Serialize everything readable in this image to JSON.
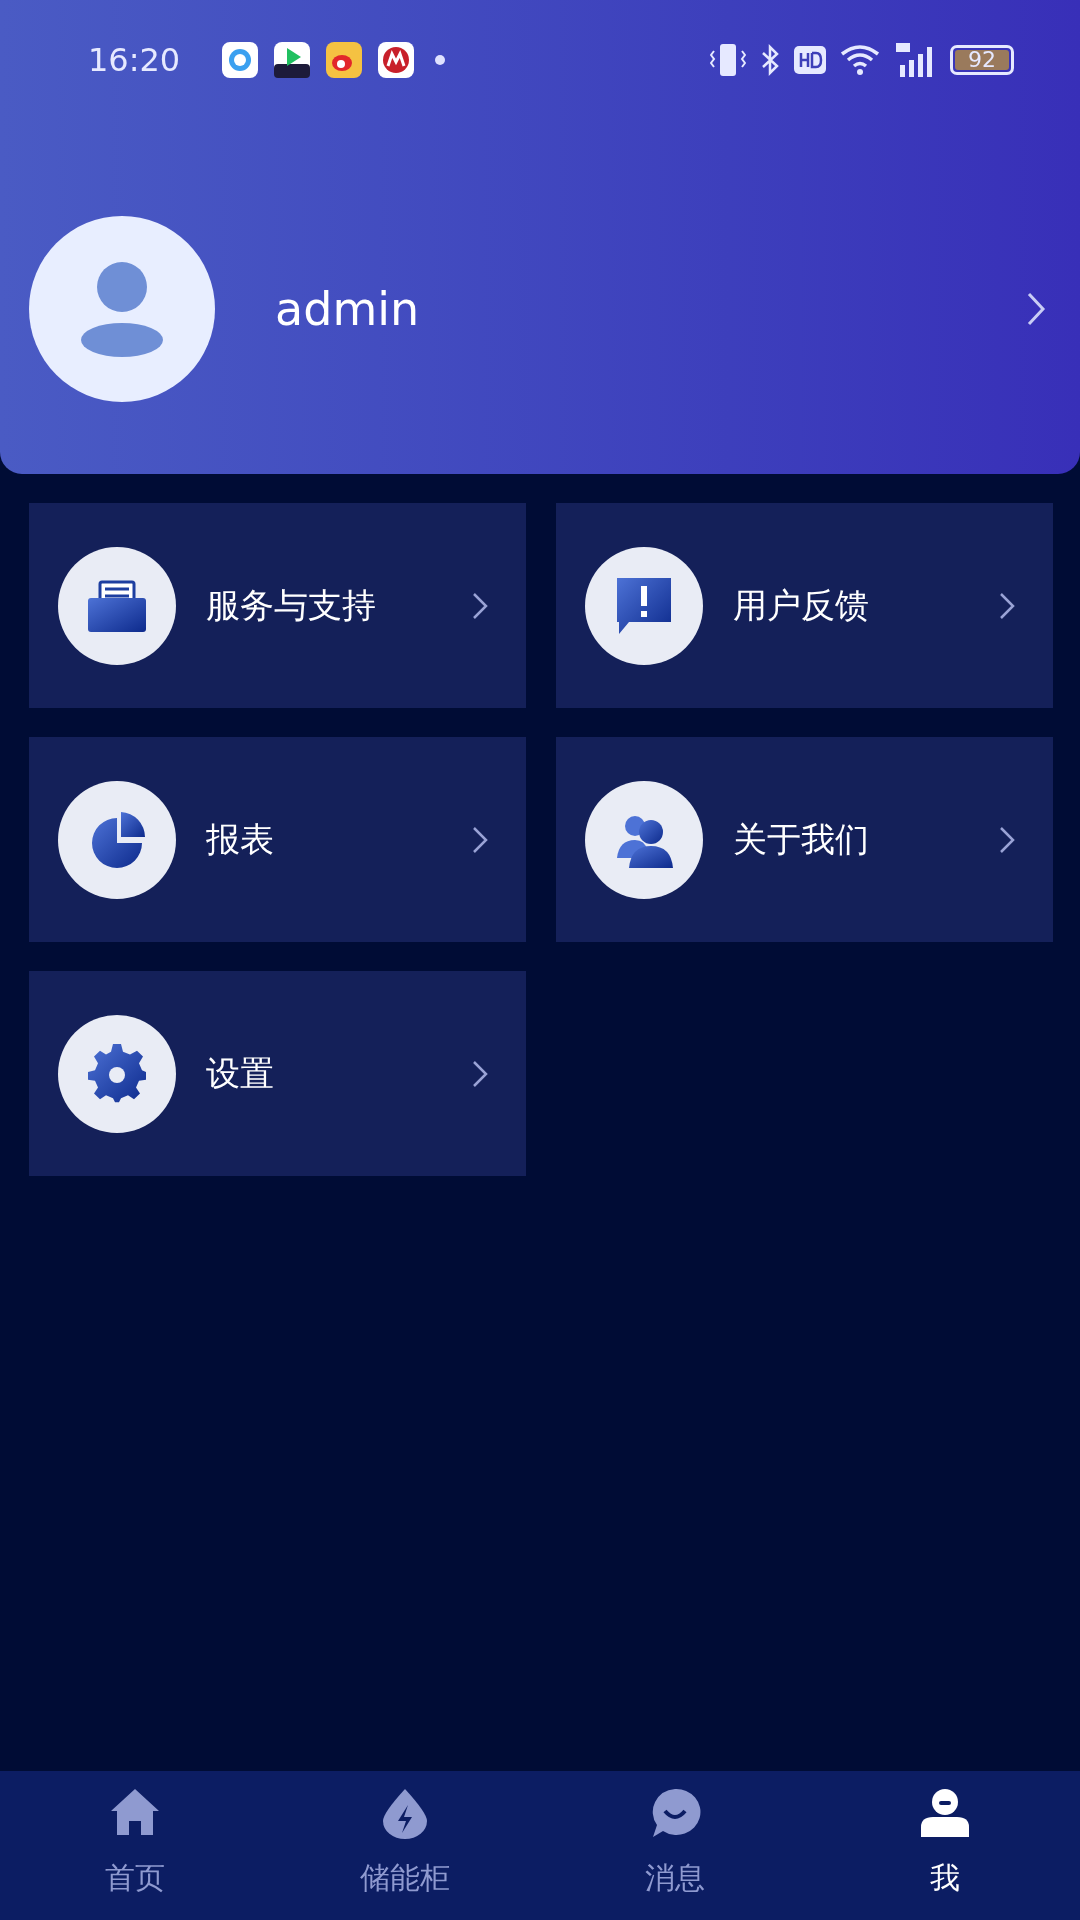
{
  "status_bar": {
    "time": "16:20",
    "battery": "92"
  },
  "profile": {
    "username": "admin"
  },
  "menu": [
    {
      "kind": "archive",
      "label": "服务与支持"
    },
    {
      "kind": "feedback",
      "label": "用户反馈"
    },
    {
      "kind": "report",
      "label": "报表"
    },
    {
      "kind": "about",
      "label": "关于我们"
    },
    {
      "kind": "settings",
      "label": "设置"
    }
  ],
  "tabs": [
    {
      "kind": "home",
      "label": "首页",
      "selected": false
    },
    {
      "kind": "storage",
      "label": "储能柜",
      "selected": false
    },
    {
      "kind": "message",
      "label": "消息",
      "selected": false
    },
    {
      "kind": "me",
      "label": "我",
      "selected": true
    }
  ]
}
